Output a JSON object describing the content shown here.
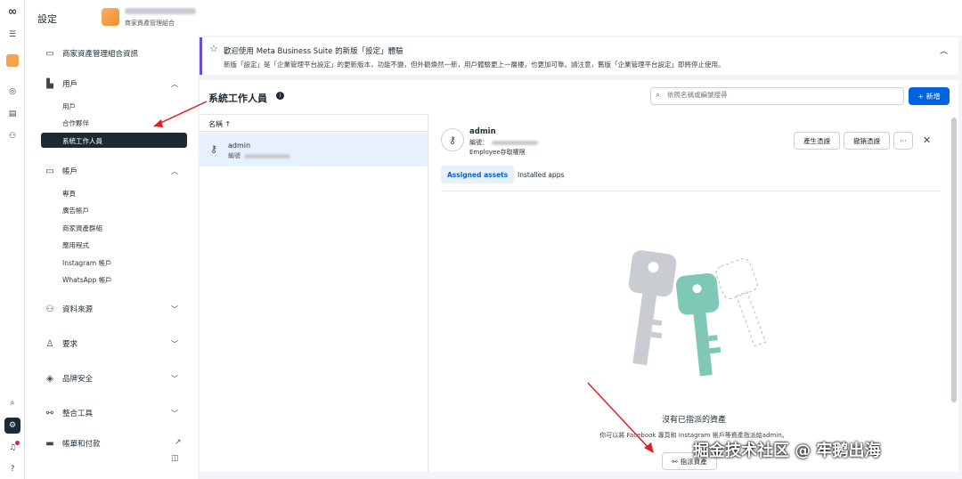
{
  "header": {
    "title": "設定",
    "business_subtitle": "商家資產管理組合"
  },
  "sidebar": {
    "business_info": "商家資產管理組合資訊",
    "users": {
      "label": "用戶",
      "items": [
        "用戶",
        "合作夥伴",
        "系統工作人員"
      ],
      "active_index": 2
    },
    "accounts": {
      "label": "帳戶",
      "items": [
        "專頁",
        "廣告帳戶",
        "商家資產群組",
        "應用程式",
        "Instagram 帳戶",
        "WhatsApp 帳戶"
      ]
    },
    "data_sources": "資料來源",
    "requests": "要求",
    "brand_safety": "品牌安全",
    "integrations": "整合工具",
    "billing": "帳單和付款"
  },
  "banner": {
    "title": "歡迎使用 Meta Business Suite 的新版「設定」體驗",
    "text": "新版「設定」是「企業管理平台設定」的更新版本，功能不變，但外觀煥然一新，用戶體驗更上一層樓，也更加可靠。請注意，舊版「企業管理平台設定」即將停止使用。"
  },
  "main": {
    "heading": "系統工作人員",
    "search_placeholder": "依照名稱或編號搜尋",
    "add_button": "+ 新增",
    "list_header": "名稱 ↑",
    "rows": [
      {
        "name": "admin",
        "id_label": "編號"
      }
    ]
  },
  "detail": {
    "name": "admin",
    "id_label": "編號：",
    "role": "Employee存取權限",
    "btn_generate": "產生憑證",
    "btn_revoke": "撤銷憑證",
    "btn_more": "···",
    "tabs": [
      "Assigned assets",
      "Installed apps"
    ],
    "empty_title": "沒有已指派的資產",
    "empty_text": "你可以將 Facebook 專頁和 Instagram 帳戶等資產指派給admin。",
    "assign_button": "指派資產"
  },
  "watermark": "掘金技术社区 @ 牢鹅出海",
  "colors": {
    "primary": "#0064e0",
    "dark": "#1c2b33",
    "accent": "#6b4fcf"
  }
}
